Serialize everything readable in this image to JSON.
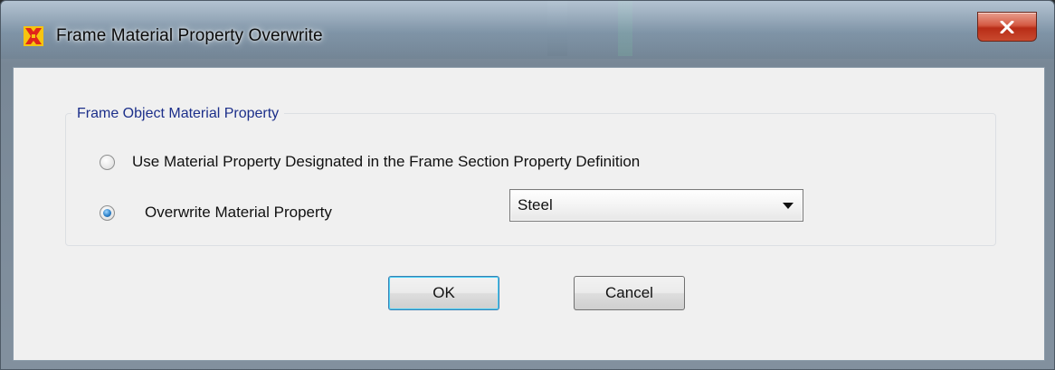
{
  "window": {
    "title": "Frame Material Property Overwrite",
    "icon": "app-icon",
    "close_icon": "close-icon"
  },
  "group": {
    "legend": "Frame Object Material Property",
    "options": [
      {
        "label": "Use Material Property Designated in the Frame Section Property Definition",
        "selected": false
      },
      {
        "label": "Overwrite Material Property",
        "selected": true
      }
    ]
  },
  "material_select": {
    "value": "Steel"
  },
  "buttons": {
    "ok": "OK",
    "cancel": "Cancel"
  },
  "colors": {
    "legend": "#1c2f8a",
    "close_button": "#c9492e",
    "radio_dot": "#2f82c9"
  }
}
